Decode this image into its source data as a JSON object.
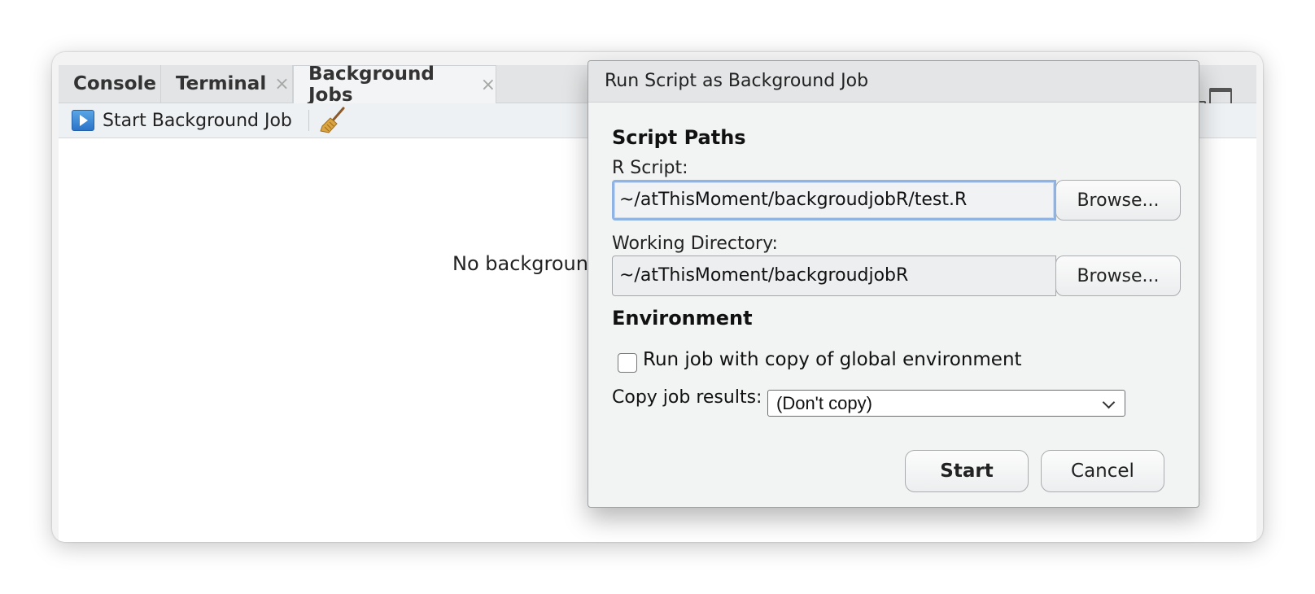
{
  "panel": {
    "tabs": [
      {
        "label": "Console",
        "closable": false
      },
      {
        "label": "Terminal",
        "closable": true
      },
      {
        "label": "Background Jobs",
        "closable": true,
        "active": true
      }
    ],
    "close_glyph": "×",
    "toolbar": {
      "start_label": "Start Background Job",
      "start_icon": "play-icon",
      "clear_icon": "broom-icon"
    },
    "empty_message": "No backgroun"
  },
  "dialog": {
    "title": "Run Script as Background Job",
    "script_paths_heading": "Script Paths",
    "r_script_label": "R Script:",
    "r_script_value": "~/atThisMoment/backgroudjobR/test.R",
    "working_dir_label": "Working Directory:",
    "working_dir_value": "~/atThisMoment/backgroudjobR",
    "browse_label": "Browse...",
    "environment_heading": "Environment",
    "copy_env_label": "Run job with copy of global environment",
    "copy_env_checked": false,
    "copy_results_label": "Copy job results:",
    "copy_results_value": "(Don't copy)",
    "start_label": "Start",
    "cancel_label": "Cancel"
  },
  "colors": {
    "accent_focus": "#8fb4e3",
    "start_icon": "#2c74c9"
  }
}
